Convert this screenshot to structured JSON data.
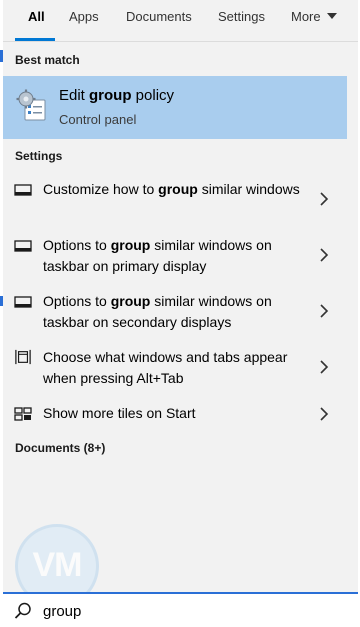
{
  "tabs": [
    {
      "label": "All",
      "active": true
    },
    {
      "label": "Apps"
    },
    {
      "label": "Documents"
    },
    {
      "label": "Settings"
    },
    {
      "label": "More"
    }
  ],
  "sections": {
    "best_match": "Best match",
    "settings": "Settings",
    "documents": "Documents (8+)"
  },
  "best_match": {
    "title_prefix": "Edit ",
    "title_bold": "group",
    "title_suffix": " policy",
    "subtitle": "Control panel",
    "icon": "group-policy-icon"
  },
  "settings_items": [
    {
      "prefix": "Customize how to ",
      "bold": "group",
      "suffix": " similar windows",
      "icon": "taskbar-icon"
    },
    {
      "prefix": "Options to ",
      "bold": "group",
      "suffix": " similar windows on taskbar on primary display",
      "icon": "taskbar-icon"
    },
    {
      "prefix": "Options to ",
      "bold": "group",
      "suffix": " similar windows on taskbar on secondary displays",
      "icon": "taskbar-icon"
    },
    {
      "prefix": "",
      "bold": "",
      "suffix": "Choose what windows and tabs appear when pressing Alt+Tab",
      "icon": "multitasking-icon"
    },
    {
      "prefix": "",
      "bold": "",
      "suffix": "Show more tiles on Start",
      "icon": "start-tiles-icon"
    }
  ],
  "search": {
    "value": "group",
    "icon": "search-icon"
  },
  "watermark": "VM",
  "colors": {
    "accent": "#0078d4",
    "selection": "#a9cdee",
    "panel": "#f2f2f2"
  }
}
